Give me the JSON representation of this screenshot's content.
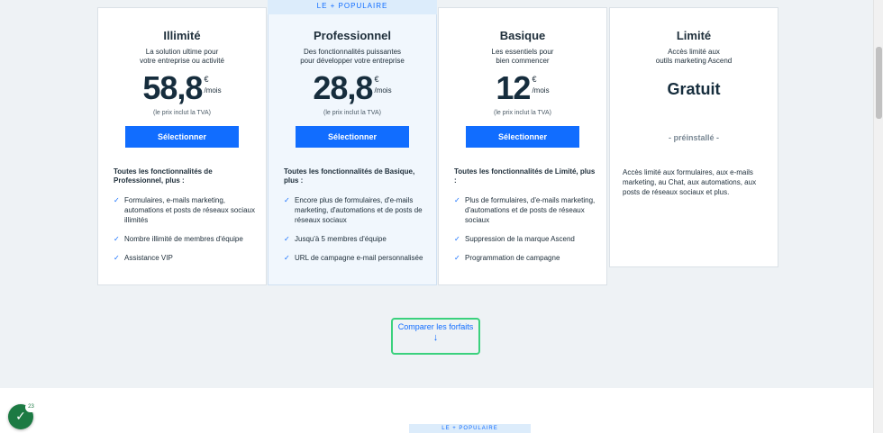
{
  "plans": [
    {
      "name": "Illimité",
      "desc_line1": "La solution ultime pour",
      "desc_line2": "votre entreprise ou activité",
      "price": "58,8",
      "currency": "€",
      "per": "/mois",
      "tax_note": "(le prix inclut la TVA)",
      "button": "Sélectionner",
      "features_heading": "Toutes les fonctionnalités de Professionnel, plus :",
      "features": [
        "Formulaires, e-mails marketing, automations et posts de réseaux sociaux illimités",
        "Nombre illimité de membres d'équipe",
        "Assistance VIP"
      ]
    },
    {
      "ribbon": "LE + POPULAIRE",
      "name": "Professionnel",
      "desc_line1": "Des fonctionnalités puissantes",
      "desc_line2": "pour développer votre entreprise",
      "price": "28,8",
      "currency": "€",
      "per": "/mois",
      "tax_note": "(le prix inclut la TVA)",
      "button": "Sélectionner",
      "features_heading": "Toutes les fonctionnalités de Basique, plus :",
      "features": [
        "Encore plus de formulaires, d'e-mails marketing, d'automations et de posts de réseaux sociaux",
        "Jusqu'à 5 membres d'équipe",
        "URL de campagne e-mail personnalisée"
      ]
    },
    {
      "name": "Basique",
      "desc_line1": "Les essentiels pour",
      "desc_line2": "bien commencer",
      "price": "12",
      "currency": "€",
      "per": "/mois",
      "tax_note": "(le prix inclut la TVA)",
      "button": "Sélectionner",
      "features_heading": "Toutes les fonctionnalités de Limité, plus :",
      "features": [
        "Plus de formulaires, d'e-mails marketing, d'automations et de posts de réseaux sociaux",
        "Suppression de la marque Ascend",
        "Programmation de campagne"
      ]
    },
    {
      "name": "Limité",
      "desc_line1": "Accès limité aux",
      "desc_line2": "outils marketing Ascend",
      "price_label": "Gratuit",
      "status": "- préinstallé -",
      "description": "Accès limité aux formulaires, aux e-mails marketing, au Chat, aux automations, aux posts de réseaux sociaux et plus."
    }
  ],
  "compare": {
    "label": "Comparer les forfaits",
    "arrow": "↓"
  },
  "lower_section": {
    "ribbon": "LE + POPULAIRE"
  },
  "badge": {
    "count": "23",
    "icon": "check-icon"
  },
  "colors": {
    "accent": "#116dff",
    "page_bg": "#eef2f5",
    "popular_bg": "#f1f7fd",
    "focus_ring": "#3ad17d",
    "badge_green": "#1c7a43"
  }
}
